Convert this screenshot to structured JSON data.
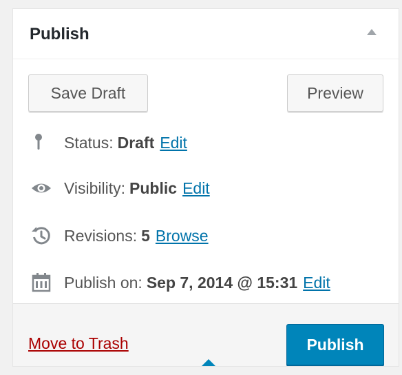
{
  "panel": {
    "title": "Publish",
    "toggle_icon": "triangle-up-icon"
  },
  "actions": {
    "save_draft_label": "Save Draft",
    "preview_label": "Preview"
  },
  "status": {
    "icon": "pin-icon",
    "label": "Status:",
    "value": "Draft",
    "edit_label": "Edit"
  },
  "visibility": {
    "icon": "eye-icon",
    "label": "Visibility:",
    "value": "Public",
    "edit_label": "Edit"
  },
  "revisions": {
    "icon": "history-icon",
    "label": "Revisions:",
    "value": "5",
    "browse_label": "Browse"
  },
  "publish_on": {
    "icon": "calendar-icon",
    "label": "Publish on:",
    "value": "Sep 7, 2014 @ 15:31",
    "edit_label": "Edit"
  },
  "footer": {
    "trash_label": "Move to Trash",
    "publish_label": "Publish"
  },
  "colors": {
    "link": "#0073aa",
    "trash": "#aa0000",
    "publish_button": "#0085ba"
  }
}
